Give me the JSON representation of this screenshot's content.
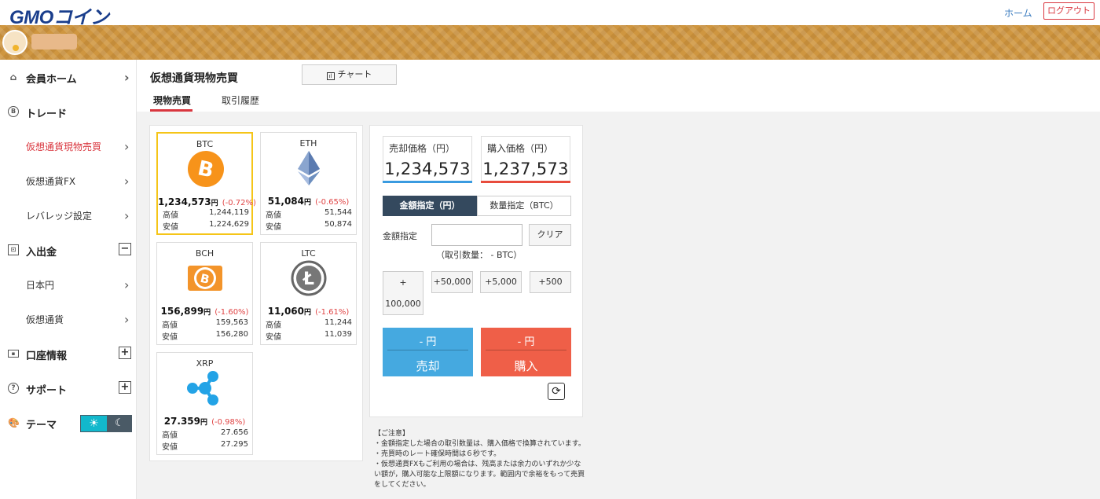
{
  "header": {
    "logo_text": "GMOコイン",
    "home_link": "ホーム",
    "logout_label": "ログアウト"
  },
  "sidebar": {
    "items": [
      {
        "label": "会員ホーム",
        "icon": "home-icon"
      },
      {
        "label": "トレード",
        "icon": "bitcoin-circle-icon"
      },
      {
        "label": "仮想通貨現物売買",
        "active": true
      },
      {
        "label": "仮想通貨FX"
      },
      {
        "label": "レバレッジ設定"
      },
      {
        "label": "入出金",
        "icon": "safe-icon",
        "expander": "−"
      },
      {
        "label": "日本円"
      },
      {
        "label": "仮想通貨"
      },
      {
        "label": "口座情報",
        "icon": "id-card-icon",
        "expander": "+"
      },
      {
        "label": "サポート",
        "icon": "question-circle-icon",
        "expander": "+"
      },
      {
        "label": "テーマ",
        "icon": "palette-icon"
      }
    ],
    "theme": {
      "light_icon": "sun-icon",
      "dark_icon": "moon-icon"
    }
  },
  "main": {
    "title": "仮想通貨現物売買",
    "chart_button": "チャート",
    "tabs": [
      {
        "label": "現物売買",
        "active": true
      },
      {
        "label": "取引履歴",
        "active": false
      }
    ]
  },
  "coins": [
    {
      "symbol": "BTC",
      "price": "1,234,573",
      "unit": "円",
      "change": "(-0.72%)",
      "high_label": "高値",
      "high": "1,244,119",
      "low_label": "安値",
      "low": "1,224,629",
      "selected": true,
      "color": "#f7931a"
    },
    {
      "symbol": "ETH",
      "price": "51,084",
      "unit": "円",
      "change": "(-0.65%)",
      "high_label": "高値",
      "high": "51,544",
      "low_label": "安値",
      "low": "50,874",
      "selected": false,
      "color": "#6d8fbf"
    },
    {
      "symbol": "BCH",
      "price": "156,899",
      "unit": "円",
      "change": "(-1.60%)",
      "high_label": "高値",
      "high": "159,563",
      "low_label": "安値",
      "low": "156,280",
      "selected": false,
      "color": "#f3942a"
    },
    {
      "symbol": "LTC",
      "price": "11,060",
      "unit": "円",
      "change": "(-1.61%)",
      "high_label": "高値",
      "high": "11,244",
      "low_label": "安値",
      "low": "11,039",
      "selected": false,
      "color": "#888888"
    },
    {
      "symbol": "XRP",
      "price": "27.359",
      "unit": "円",
      "change": "(-0.98%)",
      "high_label": "高値",
      "high": "27.656",
      "low_label": "安値",
      "low": "27.295",
      "selected": false,
      "color": "#23a3e6"
    }
  ],
  "order": {
    "sell_price_label": "売却価格（円）",
    "sell_price": "1,234,573",
    "buy_price_label": "購入価格（円）",
    "buy_price": "1,237,573",
    "mode_amount": "金額指定（円）",
    "mode_quantity": "数量指定（BTC）",
    "amount_label": "金額指定",
    "amount_value": "",
    "clear_label": "クリア",
    "qty_note": "（取引数量： - BTC）",
    "quick": {
      "big_top": "+",
      "big_bottom": "100,000",
      "b50000": "+50,000",
      "b5000": "+5,000",
      "b500": "+500"
    },
    "sell_amount": "- 円",
    "sell_label": "売却",
    "buy_amount": "- 円",
    "buy_label": "購入"
  },
  "notice": [
    "【ご注意】",
    "・金額指定した場合の取引数量は、購入価格で換算されています。",
    "・売買時のレート確保時間は６秒です。",
    "・仮想通貨FXもご利用の場合は、残高または余力のいずれか少ない額が，購入可能な上限額になります。範囲内で余裕をもって売買をしてください。"
  ],
  "colors": {
    "accent_red": "#d9363e",
    "sell_blue": "#45a9e0",
    "buy_red": "#ef5f48",
    "navy": "#34495e",
    "selected_gold": "#f5c518"
  }
}
